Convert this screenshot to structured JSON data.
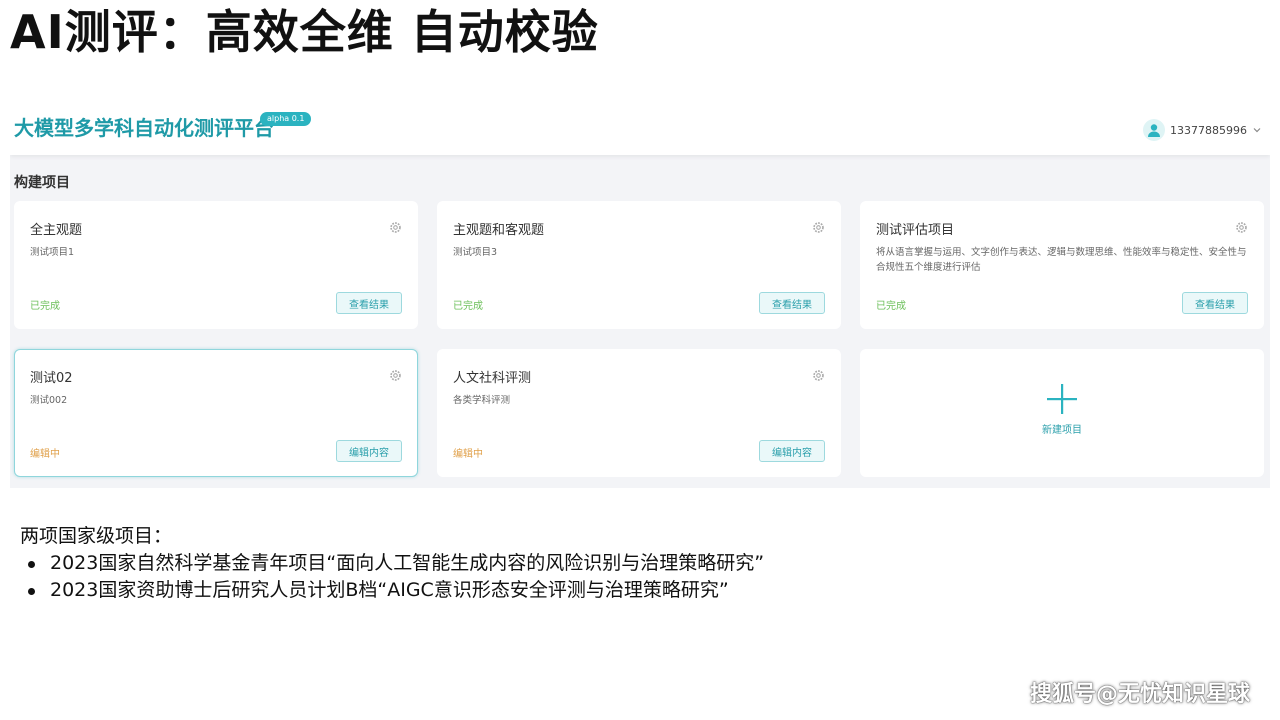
{
  "slide": {
    "title": "AI测评：高效全维 自动校验"
  },
  "app": {
    "logo": "大模型多学科自动化测评平台",
    "badge": "alpha 0.1",
    "user": {
      "phone": "13377885996",
      "avatar_icon": "user-avatar-icon",
      "dropdown_icon": "chevron-down-icon"
    },
    "section_title": "构建项目",
    "accent_color": "#2bb3c0",
    "cards": [
      {
        "title": "全主观题",
        "desc": "测试项目1",
        "status": "已完成",
        "button": "查看结果"
      },
      {
        "title": "主观题和客观题",
        "desc": "测试项目3",
        "status": "已完成",
        "button": "查看结果"
      },
      {
        "title": "测试评估项目",
        "desc": "将从语言掌握与运用、文字创作与表达、逻辑与数理思维、性能效率与稳定性、安全性与合规性五个维度进行评估",
        "status": "已完成",
        "button": "查看结果"
      },
      {
        "title": "测试02",
        "desc": "测试002",
        "status": "编辑中",
        "button": "编辑内容"
      },
      {
        "title": "人文社科评测",
        "desc": "各类学科评测",
        "status": "编辑中",
        "button": "编辑内容"
      }
    ],
    "new_project": {
      "label": "新建项目",
      "icon": "plus-icon"
    }
  },
  "notes": {
    "heading": "两项国家级项目：",
    "items": [
      "2023国家自然科学基金青年项目“面向人工智能生成内容的风险识别与治理策略研究”",
      "2023国家资助博士后研究人员计划B档“AIGC意识形态安全评测与治理策略研究”"
    ]
  },
  "watermark": "搜狐号@无忧知识星球"
}
